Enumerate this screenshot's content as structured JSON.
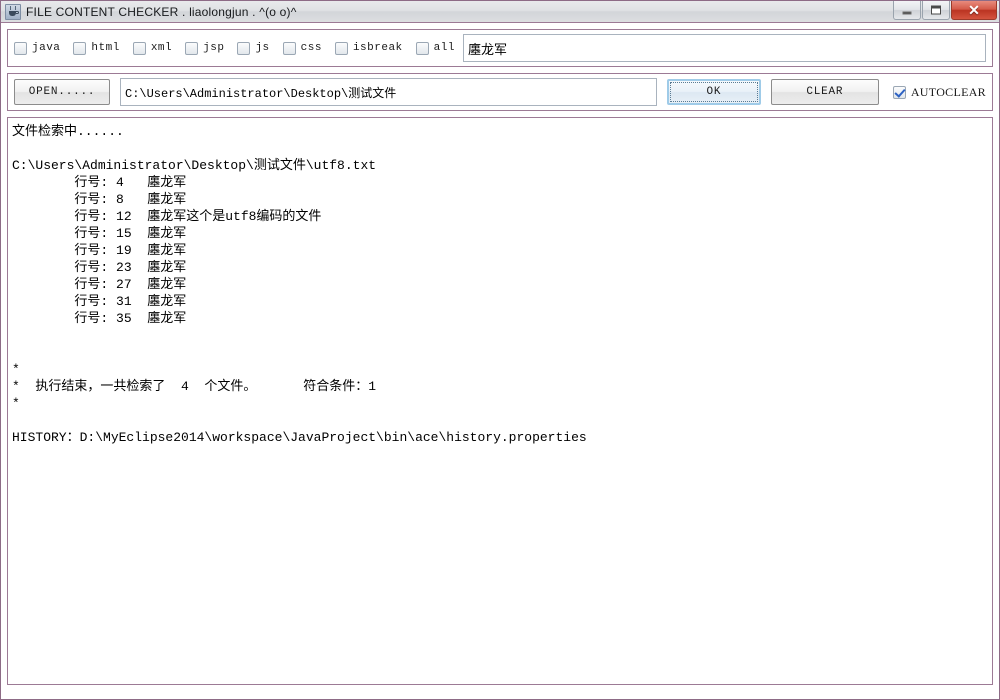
{
  "window": {
    "title": "FILE CONTENT CHECKER . liaolongjun . ^(o o)^",
    "icon": "java-cup-icon",
    "border_color": "#9c7a95",
    "controls": {
      "minimize_label": "",
      "maximize_label": "",
      "close_label": "✕"
    }
  },
  "filters": {
    "checkboxes": [
      {
        "label": "java",
        "checked": false
      },
      {
        "label": "html",
        "checked": false
      },
      {
        "label": "xml",
        "checked": false
      },
      {
        "label": "jsp",
        "checked": false
      },
      {
        "label": "js",
        "checked": false
      },
      {
        "label": "css",
        "checked": false
      },
      {
        "label": "isbreak",
        "checked": false
      },
      {
        "label": "all",
        "checked": false
      }
    ],
    "search": {
      "value": "廛龙军",
      "placeholder": ""
    }
  },
  "toolbar": {
    "open_label": "OPEN.....",
    "path": {
      "value": "C:\\Users\\Administrator\\Desktop\\测试文件",
      "placeholder": ""
    },
    "ok_label": "OK",
    "clear_label": "CLEAR",
    "autoclear": {
      "label": "AUTOCLEAR",
      "checked": true
    },
    "focus_color": "#9fcbe8"
  },
  "output": {
    "lines": [
      "文件检索中......",
      "",
      "C:\\Users\\Administrator\\Desktop\\测试文件\\utf8.txt",
      "        行号: 4   廛龙军",
      "        行号: 8   廛龙军",
      "        行号: 12  廛龙军这个是utf8编码的文件",
      "        行号: 15  廛龙军",
      "        行号: 19  廛龙军",
      "        行号: 23  廛龙军",
      "        行号: 27  廛龙军",
      "        行号: 31  廛龙军",
      "        行号: 35  廛龙军",
      "",
      "",
      "*",
      "*  执行结束，一共检索了  4  个文件。      符合条件：1",
      "*",
      "",
      "HISTORY：D:\\MyEclipse2014\\workspace\\JavaProject\\bin\\ace\\history.properties"
    ]
  }
}
